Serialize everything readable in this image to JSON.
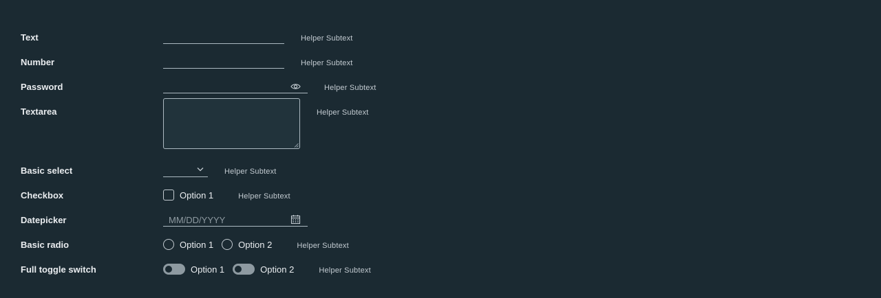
{
  "helper_text": "Helper Subtext",
  "fields": {
    "text": {
      "label": "Text"
    },
    "number": {
      "label": "Number"
    },
    "password": {
      "label": "Password"
    },
    "textarea": {
      "label": "Textarea"
    },
    "basic_select": {
      "label": "Basic select",
      "value": ""
    },
    "checkbox": {
      "label": "Checkbox",
      "option_1": "Option 1",
      "checked": false
    },
    "datepicker": {
      "label": "Datepicker",
      "placeholder": "MM/DD/YYYY"
    },
    "basic_radio": {
      "label": "Basic radio",
      "option_1": "Option 1",
      "option_2": "Option 2"
    },
    "toggle": {
      "label": "Full toggle switch",
      "option_1": "Option 1",
      "option_2": "Option 2"
    }
  },
  "icons": {
    "password_reveal": "eye-icon",
    "select_arrow": "chevron-down-icon",
    "datepicker": "calendar-icon"
  },
  "colors": {
    "background": "#1b2a32",
    "label": "#e9ecef",
    "helper": "#c3cbd1",
    "border": "#adbac2",
    "placeholder": "#8e9aa1"
  }
}
